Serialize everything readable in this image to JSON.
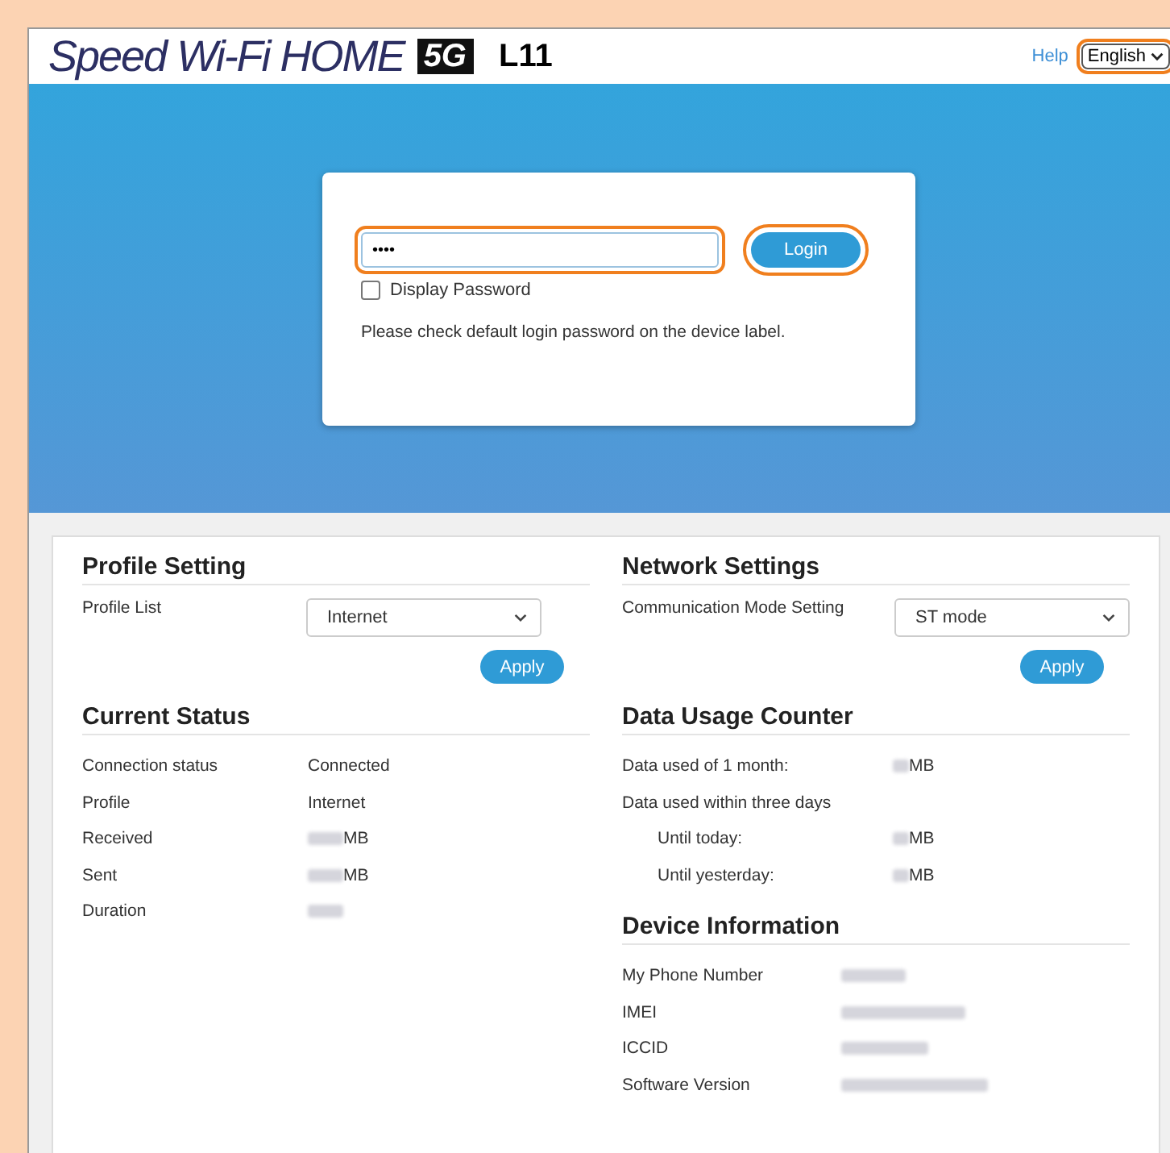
{
  "header": {
    "logo": {
      "brand": "Speed Wi-Fi HOME",
      "badge": "5G",
      "model": "L11"
    },
    "help_link": "Help",
    "language": {
      "value": "English",
      "highlighted": true
    }
  },
  "login": {
    "password": {
      "value": "••••",
      "highlighted": true
    },
    "login_button": {
      "label": "Login",
      "highlighted": true
    },
    "display_password": {
      "label": "Display Password",
      "checked": false
    },
    "note": "Please check default login password on the device label."
  },
  "profile_setting": {
    "title": "Profile Setting",
    "label": "Profile List",
    "value": "Internet",
    "apply": "Apply"
  },
  "current_status": {
    "title": "Current Status",
    "rows": [
      {
        "label": "Connection status",
        "value": "Connected",
        "blurred": false
      },
      {
        "label": "Profile",
        "value": "Internet",
        "blurred": false
      },
      {
        "label": "Received",
        "value": "MB",
        "blurred": true
      },
      {
        "label": "Sent",
        "value": "MB",
        "blurred": true
      },
      {
        "label": "Duration",
        "blurred": true
      }
    ]
  },
  "network_settings": {
    "title": "Network Settings",
    "label": "Communication Mode Setting",
    "value": "ST mode",
    "apply": "Apply"
  },
  "data_usage_counter": {
    "title": "Data Usage Counter",
    "rows": [
      {
        "label": "Data used of 1 month:",
        "value": "MB",
        "blurred": true
      },
      {
        "label": "Data used within three days",
        "children": [
          {
            "label": "Until today:",
            "value": "MB",
            "blurred": true
          },
          {
            "label": "Until yesterday:",
            "value": "MB",
            "blurred": true
          }
        ]
      }
    ]
  },
  "device_information": {
    "title": "Device Information",
    "rows": [
      {
        "label": "My Phone Number",
        "blurred": true
      },
      {
        "label": "IMEI",
        "blurred": true
      },
      {
        "label": "ICCID",
        "blurred": true
      },
      {
        "label": "Software Version",
        "blurred": true
      }
    ]
  }
}
